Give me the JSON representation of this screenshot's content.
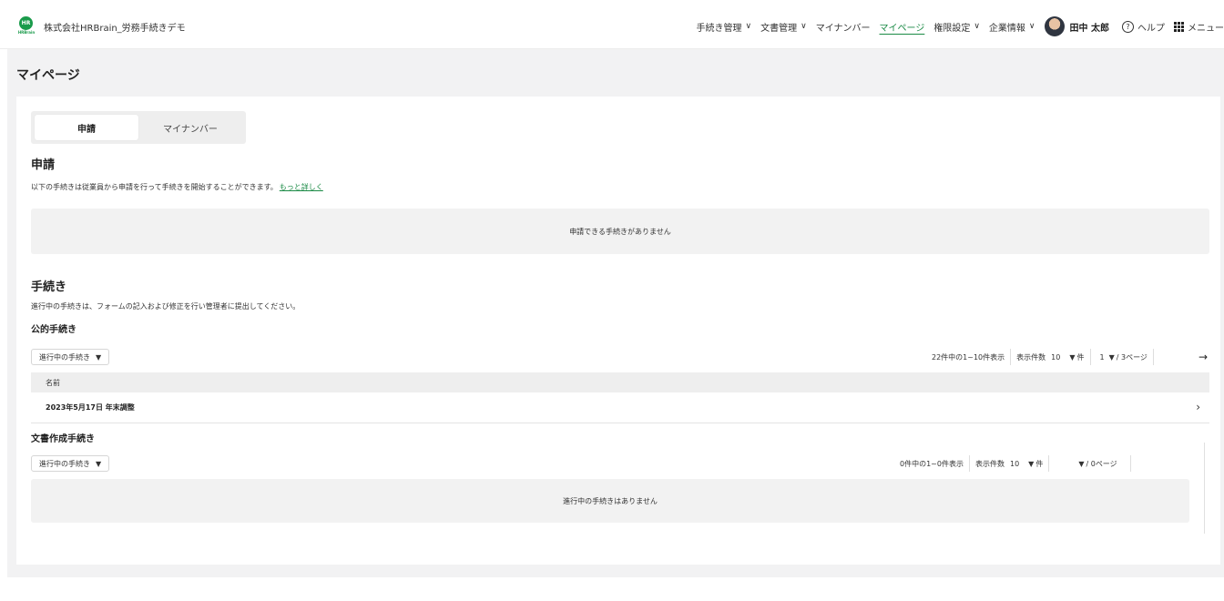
{
  "header": {
    "logo_text": "HR",
    "logo_sub": "HRBrain",
    "company": "株式会社HRBrain_労務手続きデモ",
    "nav": [
      {
        "label": "手続き管理",
        "dropdown": true
      },
      {
        "label": "文書管理",
        "dropdown": true
      },
      {
        "label": "マイナンバー",
        "dropdown": false
      },
      {
        "label": "マイページ",
        "dropdown": false,
        "active": true
      },
      {
        "label": "権限設定",
        "dropdown": true
      },
      {
        "label": "企業情報",
        "dropdown": true
      }
    ],
    "user_name": "田中 太郎",
    "help_label": "ヘルプ",
    "menu_label": "メニュー"
  },
  "page": {
    "title": "マイページ",
    "tabs": [
      "申請",
      "マイナンバー"
    ],
    "active_tab": 0
  },
  "application": {
    "heading": "申請",
    "description": "以下の手続きは従業員から申請を行って手続きを開始することができます。",
    "link": "もっと詳しく",
    "empty_message": "申請できる手続きがありません"
  },
  "procedures": {
    "heading": "手続き",
    "description": "進行中の手続きは、フォームの記入および修正を行い管理者に提出してください。",
    "public": {
      "heading": "公的手続き",
      "filter": "進行中の手続き",
      "count_text": "22件中の1~10件表示",
      "per_page_label": "表示件数",
      "per_page": "10",
      "per_page_unit": "件",
      "page": "1",
      "page_total": "/ 3ページ",
      "column_name": "名前",
      "rows": [
        "2023年5月17日 年末調整"
      ]
    },
    "document": {
      "heading": "文書作成手続き",
      "filter": "進行中の手続き",
      "count_text": "0件中の1~0件表示",
      "per_page_label": "表示件数",
      "per_page": "10",
      "per_page_unit": "件",
      "page_total": "/ 0ページ",
      "empty_message": "進行中の手続きはありません"
    }
  }
}
